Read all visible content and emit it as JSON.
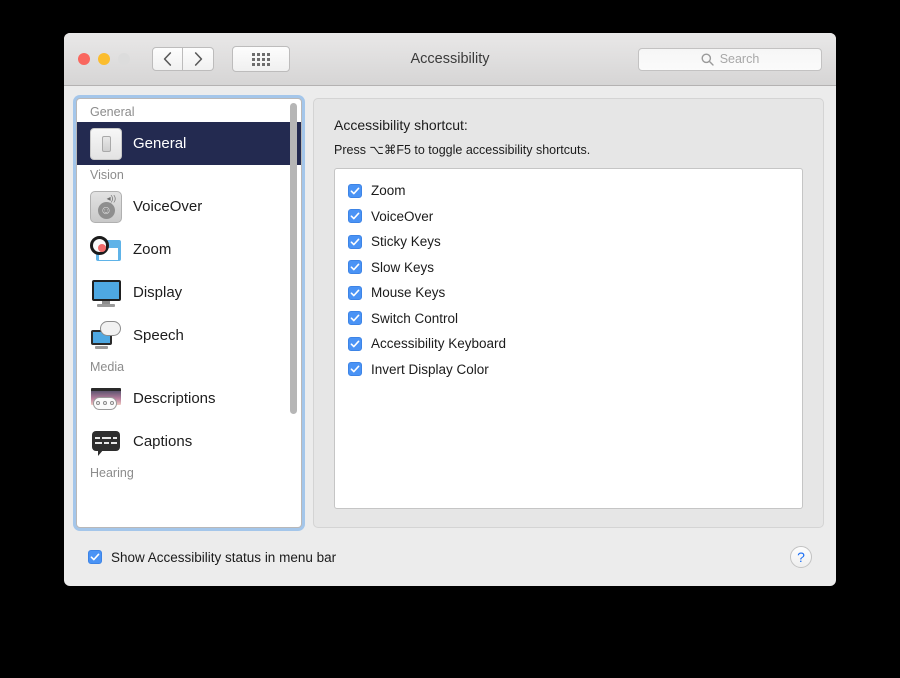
{
  "window": {
    "title": "Accessibility",
    "traffic_lights": {
      "close_label": "Close",
      "minimize_label": "Minimize",
      "zoom_label": "Zoom"
    },
    "nav": {
      "back_label": "Back",
      "forward_label": "Forward",
      "show_all_label": "Show All"
    },
    "search": {
      "placeholder": "Search",
      "value": ""
    }
  },
  "sidebar": {
    "groups": [
      {
        "header": "General",
        "items": [
          {
            "label": "General",
            "icon": "general-switch-icon",
            "selected": true
          }
        ]
      },
      {
        "header": "Vision",
        "items": [
          {
            "label": "VoiceOver",
            "icon": "voiceover-icon",
            "selected": false
          },
          {
            "label": "Zoom",
            "icon": "zoom-magnifier-icon",
            "selected": false
          },
          {
            "label": "Display",
            "icon": "display-monitor-icon",
            "selected": false
          },
          {
            "label": "Speech",
            "icon": "speech-bubble-icon",
            "selected": false
          }
        ]
      },
      {
        "header": "Media",
        "items": [
          {
            "label": "Descriptions",
            "icon": "descriptions-icon",
            "selected": false
          },
          {
            "label": "Captions",
            "icon": "captions-icon",
            "selected": false
          }
        ]
      },
      {
        "header": "Hearing",
        "items": []
      }
    ],
    "selected_color": "#232a50",
    "focus_ring_color": "#7eb2e9"
  },
  "main": {
    "title": "Accessibility shortcut:",
    "subtitle": "Press ⌥⌘F5 to toggle accessibility shortcuts.",
    "shortcut_options": [
      {
        "label": "Zoom",
        "checked": true
      },
      {
        "label": "VoiceOver",
        "checked": true
      },
      {
        "label": "Sticky Keys",
        "checked": true
      },
      {
        "label": "Slow Keys",
        "checked": true
      },
      {
        "label": "Mouse Keys",
        "checked": true
      },
      {
        "label": "Switch Control",
        "checked": true
      },
      {
        "label": "Accessibility Keyboard",
        "checked": true
      },
      {
        "label": "Invert Display Color",
        "checked": true
      }
    ],
    "checkbox_color": "#4a93f5"
  },
  "footer": {
    "menu_bar_checkbox": {
      "label": "Show Accessibility status in menu bar",
      "checked": true
    },
    "help_label": "?"
  }
}
